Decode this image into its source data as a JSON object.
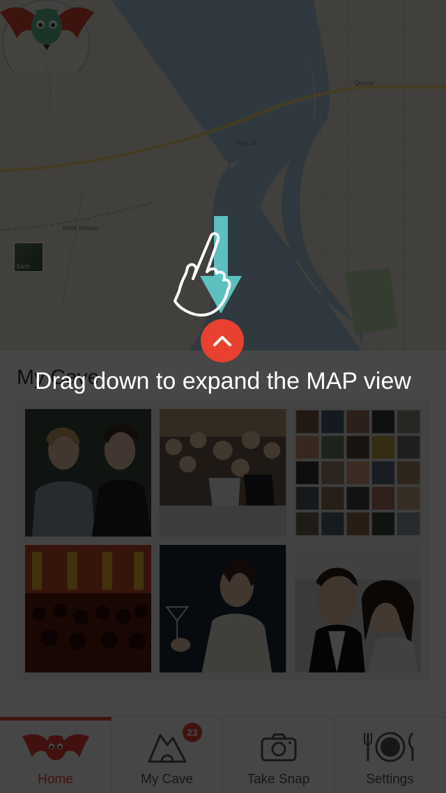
{
  "map": {
    "labels": {
      "quincy": "Quincy",
      "hwy24": "Hwy 24",
      "bnsf": "BNSF Railway",
      "earth": "Earth"
    },
    "earth_thumb_label": "Earth"
  },
  "panel": {
    "title": "My Cave",
    "photos": [
      {
        "name": "two-women-portrait"
      },
      {
        "name": "concert-crowd"
      },
      {
        "name": "photo-collage"
      },
      {
        "name": "party-hall"
      },
      {
        "name": "woman-with-cocktail"
      },
      {
        "name": "couple-selfie"
      }
    ]
  },
  "overlay": {
    "hint_text": "Drag down to expand the MAP view"
  },
  "tabs": [
    {
      "label": "Home",
      "icon": "bat-icon",
      "active": true
    },
    {
      "label": "My Cave",
      "icon": "cave-icon",
      "badge": "23"
    },
    {
      "label": "Take Snap",
      "icon": "camera-icon"
    },
    {
      "label": "Settings",
      "icon": "plate-cutlery-icon"
    }
  ],
  "colors": {
    "accent": "#e8412f",
    "arrow": "#5bc0be",
    "map_bg": "#eae4da",
    "river": "#9ec4de"
  }
}
